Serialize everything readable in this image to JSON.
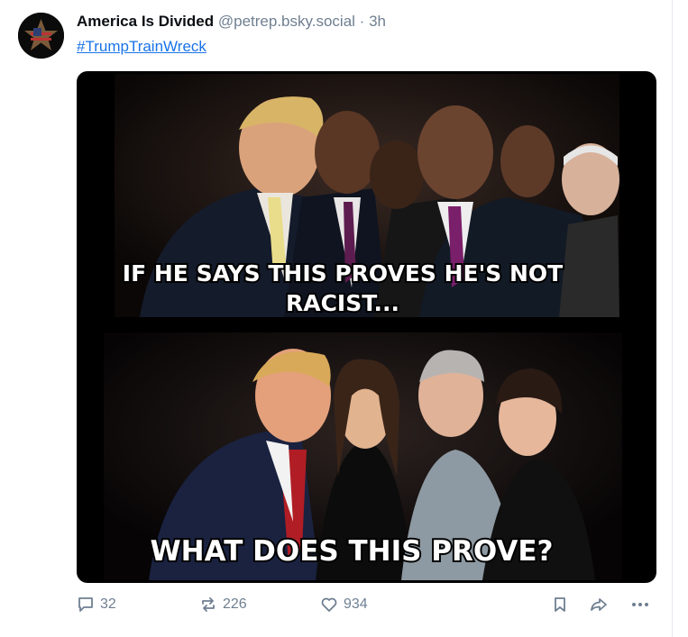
{
  "post": {
    "author_name": "America Is Divided",
    "handle": "@petrep.bsky.social",
    "separator": "·",
    "time": "3h",
    "hashtag": "#TrumpTrainWreck"
  },
  "meme": {
    "top_caption_line1": "IF HE SAYS THIS PROVES HE'S NOT",
    "top_caption_line2": "RACIST...",
    "bottom_caption": "WHAT DOES THIS PROVE?"
  },
  "actions": {
    "replies": "32",
    "reposts": "226",
    "likes": "934"
  },
  "icons": {
    "reply": "speech-bubble-icon",
    "repost": "repost-arrows-icon",
    "like": "heart-icon",
    "bookmark": "bookmark-icon",
    "share": "share-arrow-icon",
    "more": "ellipsis-icon"
  },
  "colors": {
    "link": "#1a73e8",
    "muted": "#6f7f91",
    "text": "#0b0f14"
  }
}
